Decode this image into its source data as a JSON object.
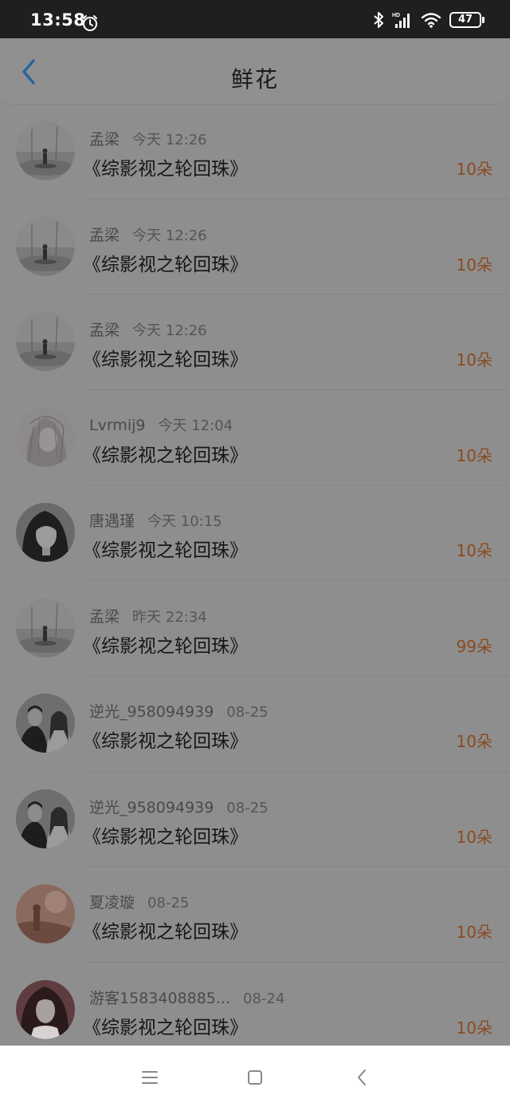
{
  "status_bar": {
    "time": "13:58",
    "battery": "47",
    "icons": [
      "alarm-icon",
      "bluetooth-icon",
      "signal-icon",
      "wifi-icon",
      "battery-icon"
    ]
  },
  "header": {
    "title": "鲜花",
    "back_icon": "chevron-left-icon"
  },
  "colors": {
    "accent": "#2a63a0",
    "count_color": "#8b4a1f",
    "overlay": "#8e8e8e"
  },
  "items": [
    {
      "user": "孟梁",
      "time": "今天 12:26",
      "book": "《综影视之轮回珠》",
      "count": "10朵",
      "avatar": "lake-figure"
    },
    {
      "user": "孟梁",
      "time": "今天 12:26",
      "book": "《综影视之轮回珠》",
      "count": "10朵",
      "avatar": "lake-figure"
    },
    {
      "user": "孟梁",
      "time": "今天 12:26",
      "book": "《综影视之轮回珠》",
      "count": "10朵",
      "avatar": "lake-figure"
    },
    {
      "user": "Lvrmij9",
      "time": "今天 12:04",
      "book": "《综影视之轮回珠》",
      "count": "10朵",
      "avatar": "sketch-girl"
    },
    {
      "user": "唐遇瑾",
      "time": "今天 10:15",
      "book": "《综影视之轮回珠》",
      "count": "10朵",
      "avatar": "dark-hair-girl"
    },
    {
      "user": "孟梁",
      "time": "昨天 22:34",
      "book": "《综影视之轮回珠》",
      "count": "99朵",
      "avatar": "lake-figure"
    },
    {
      "user": "逆光_958094939",
      "time": "08-25",
      "book": "《综影视之轮回珠》",
      "count": "10朵",
      "avatar": "couple"
    },
    {
      "user": "逆光_958094939",
      "time": "08-25",
      "book": "《综影视之轮回珠》",
      "count": "10朵",
      "avatar": "couple"
    },
    {
      "user": "夏凌璇",
      "time": "08-25",
      "book": "《综影视之轮回珠》",
      "count": "10朵",
      "avatar": "warm-scene"
    },
    {
      "user": "游客1583408885...",
      "time": "08-24",
      "book": "《综影视之轮回珠》",
      "count": "10朵",
      "avatar": "portrait-girl"
    }
  ],
  "nav_bar": {
    "buttons": [
      "menu-icon",
      "home-icon",
      "back-icon"
    ]
  }
}
